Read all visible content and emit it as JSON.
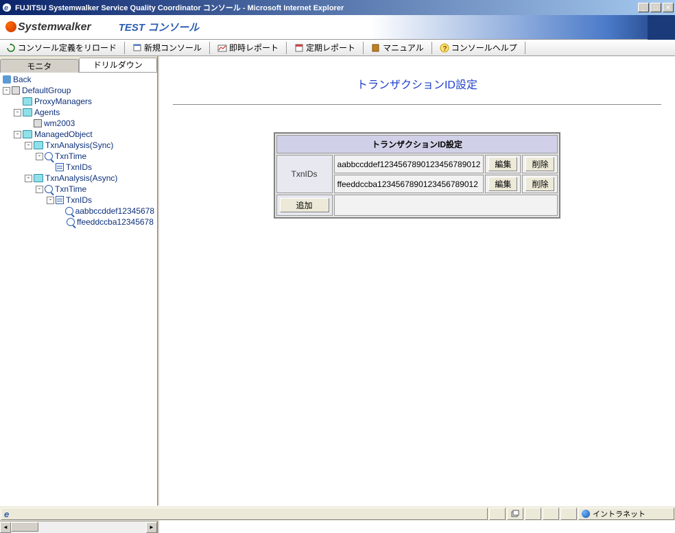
{
  "window": {
    "title": "FUJITSU Systemwalker Service Quality Coordinator コンソール - Microsoft Internet Explorer"
  },
  "brand": {
    "logo": "Systemwalker",
    "subtitle": "TEST コンソール"
  },
  "toolbar": {
    "reload": "コンソール定義をリロード",
    "newConsole": "新規コンソール",
    "instantReport": "即時レポート",
    "periodicReport": "定期レポート",
    "manual": "マニュアル",
    "help": "コンソールヘルプ"
  },
  "tabs": {
    "monitor": "モニタ",
    "drilldown": "ドリルダウン"
  },
  "tree": {
    "back": "Back",
    "defaultGroup": "DefaultGroup",
    "proxyManagers": "ProxyManagers",
    "agents": "Agents",
    "wm2003": "wm2003",
    "managedObject": "ManagedObject",
    "txnAnalysisSync": "TxnAnalysis(Sync)",
    "txnTime1": "TxnTime",
    "txnIds1": "TxnIDs",
    "txnAnalysisAsync": "TxnAnalysis(Async)",
    "txnTime2": "TxnTime",
    "txnIds2": "TxnIDs",
    "id1": "aabbccddef12345678",
    "id2": "ffeeddccba12345678"
  },
  "content": {
    "title": "トランザクションID設定",
    "tableHeader": "トランザクションID設定",
    "labelTxnIds": "TxnIDs",
    "rows": [
      {
        "id": "aabbccddef1234567890123456789012"
      },
      {
        "id": "ffeeddccba1234567890123456789012"
      }
    ],
    "editBtn": "編集",
    "deleteBtn": "削除",
    "addBtn": "追加"
  },
  "status": {
    "zone": "イントラネット"
  }
}
